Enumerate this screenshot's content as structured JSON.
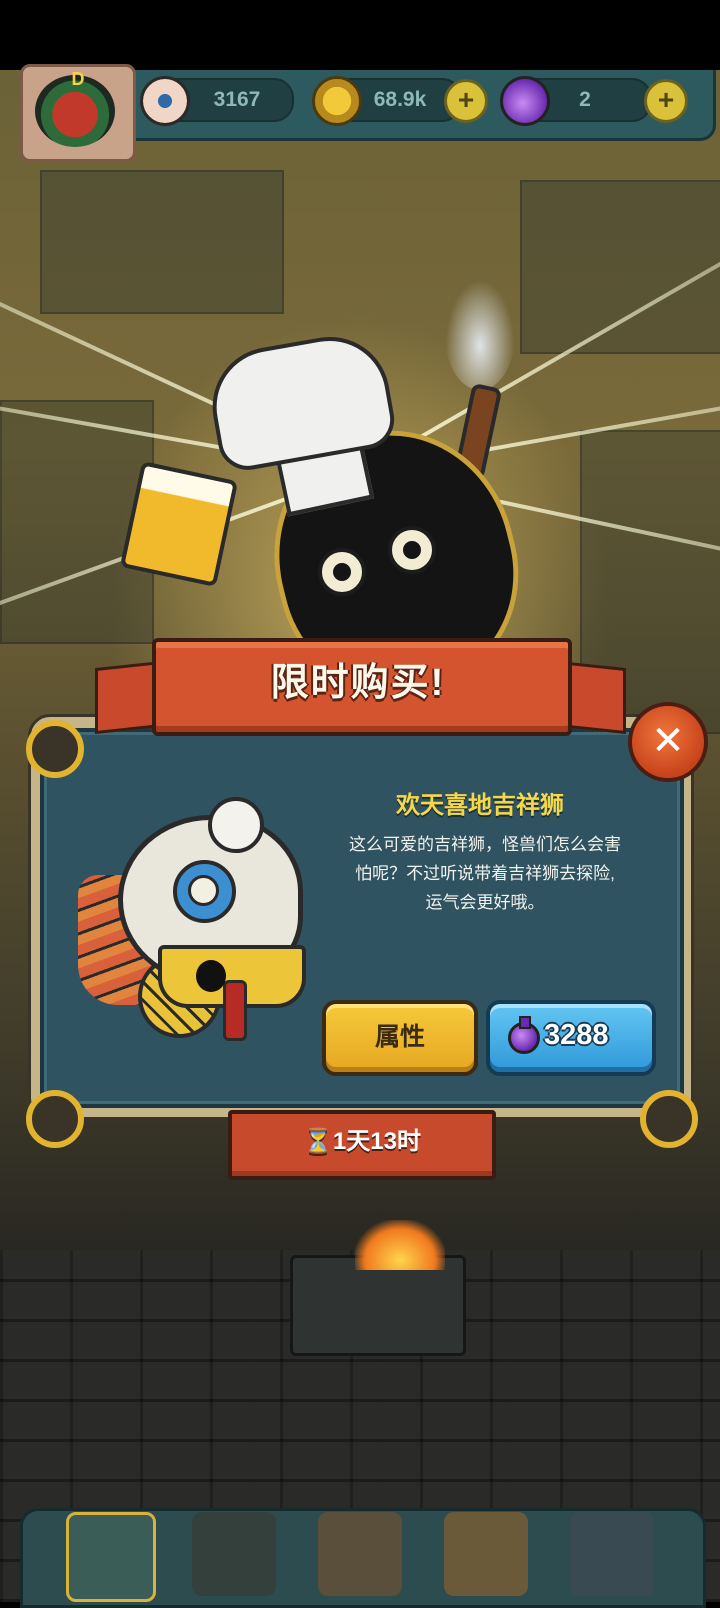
{
  "resources": {
    "eye_count": "3167",
    "coins": "68.9k",
    "potions": "2",
    "avatar_letter": "D"
  },
  "offer": {
    "banner_title": "限时购买!",
    "item_name": "欢天喜地吉祥狮",
    "description_lines": [
      "这么可爱的吉祥狮，怪兽们怎么会害",
      "怕呢？不过听说带着吉祥狮去探险,",
      "运气会更好哦。"
    ],
    "attributes_label": "属性",
    "price": "3288",
    "timer": "⏳1天13时"
  },
  "colors": {
    "ribbon": "#d4542f",
    "panel": "#2f5360",
    "gold_title": "#f4d84a",
    "buy_button": "#2f98d8",
    "attr_button": "#f6c93b"
  },
  "icons": {
    "eye_resource": "eyeball-icon",
    "coin_resource": "coin-icon",
    "potion_resource": "potion-icon",
    "close": "close-icon",
    "price": "potion-icon",
    "timer": "hourglass-icon"
  }
}
